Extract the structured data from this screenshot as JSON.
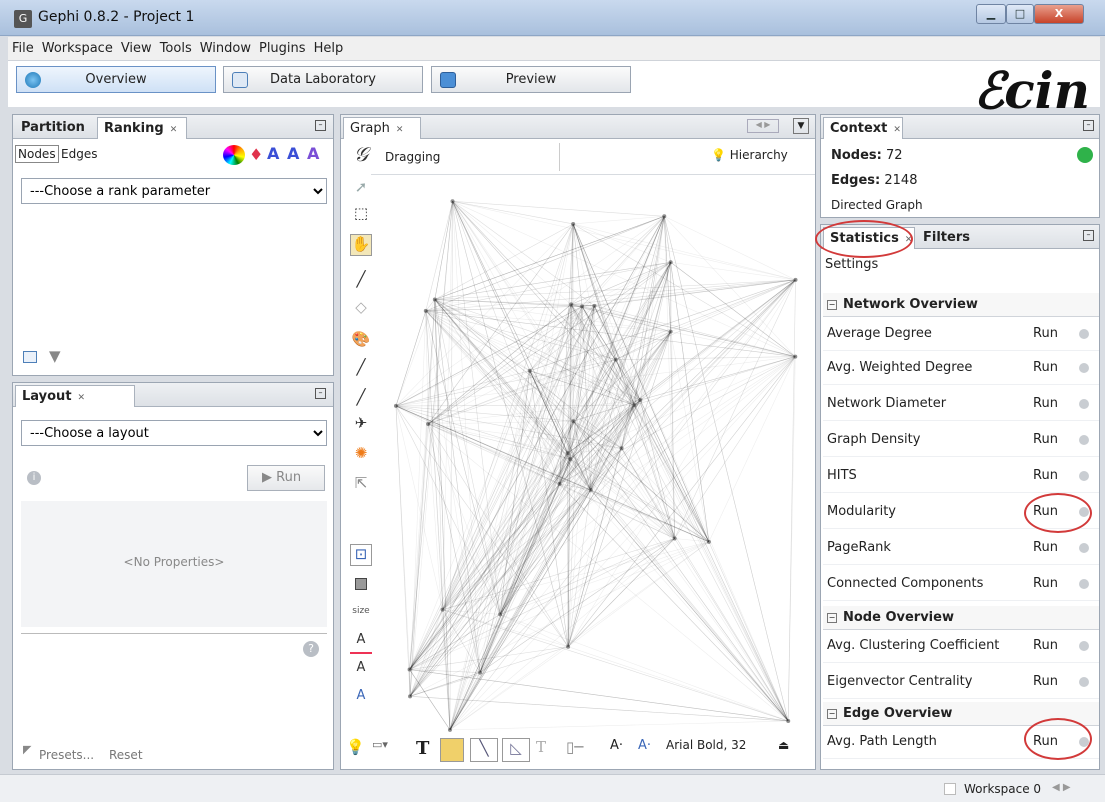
{
  "window": {
    "title": "Gephi 0.8.2 - Project 1",
    "icon": "gephi-app-icon"
  },
  "menu": [
    "File",
    "Workspace",
    "View",
    "Tools",
    "Window",
    "Plugins",
    "Help"
  ],
  "modes": {
    "overview": "Overview",
    "data_lab": "Data Laboratory",
    "preview": "Preview"
  },
  "ranking_panel": {
    "tabs": {
      "partition": "Partition",
      "ranking": "Ranking"
    },
    "subtabs": {
      "nodes": "Nodes",
      "edges": "Edges"
    },
    "rank_param": "---Choose a rank parameter"
  },
  "layout_panel": {
    "title": "Layout",
    "choose": "---Choose a layout",
    "run": "Run",
    "no_props": "<No Properties>",
    "presets": "Presets...",
    "reset": "Reset"
  },
  "graph_panel": {
    "tab": "Graph",
    "dragging": "Dragging",
    "hierarchy": "Hierarchy",
    "size_label": "size",
    "font": "Arial Bold, 32"
  },
  "context_panel": {
    "title": "Context",
    "nodes_label": "Nodes:",
    "nodes_value": "72",
    "edges_label": "Edges:",
    "edges_value": "2148",
    "graph_type": "Directed Graph"
  },
  "stats_panel": {
    "tabs": {
      "statistics": "Statistics",
      "filters": "Filters"
    },
    "settings": "Settings",
    "network_overview": "Network Overview",
    "node_overview": "Node Overview",
    "edge_overview": "Edge Overview",
    "run_label": "Run",
    "rows": {
      "average_degree": "Average Degree",
      "avg_weighted_degree": "Avg. Weighted Degree",
      "network_diameter": "Network Diameter",
      "graph_density": "Graph Density",
      "hits": "HITS",
      "modularity": "Modularity",
      "pagerank": "PageRank",
      "connected_components": "Connected Components",
      "avg_clustering": "Avg. Clustering Coefficient",
      "eigenvector": "Eigenvector Centrality",
      "avg_path_length": "Avg. Path Length"
    }
  },
  "statusbar": {
    "workspace": "Workspace 0"
  },
  "colors": {
    "accent": "#6a92c6",
    "highlight_circle": "#d23a3a",
    "green_indicator": "#2fb24a"
  }
}
